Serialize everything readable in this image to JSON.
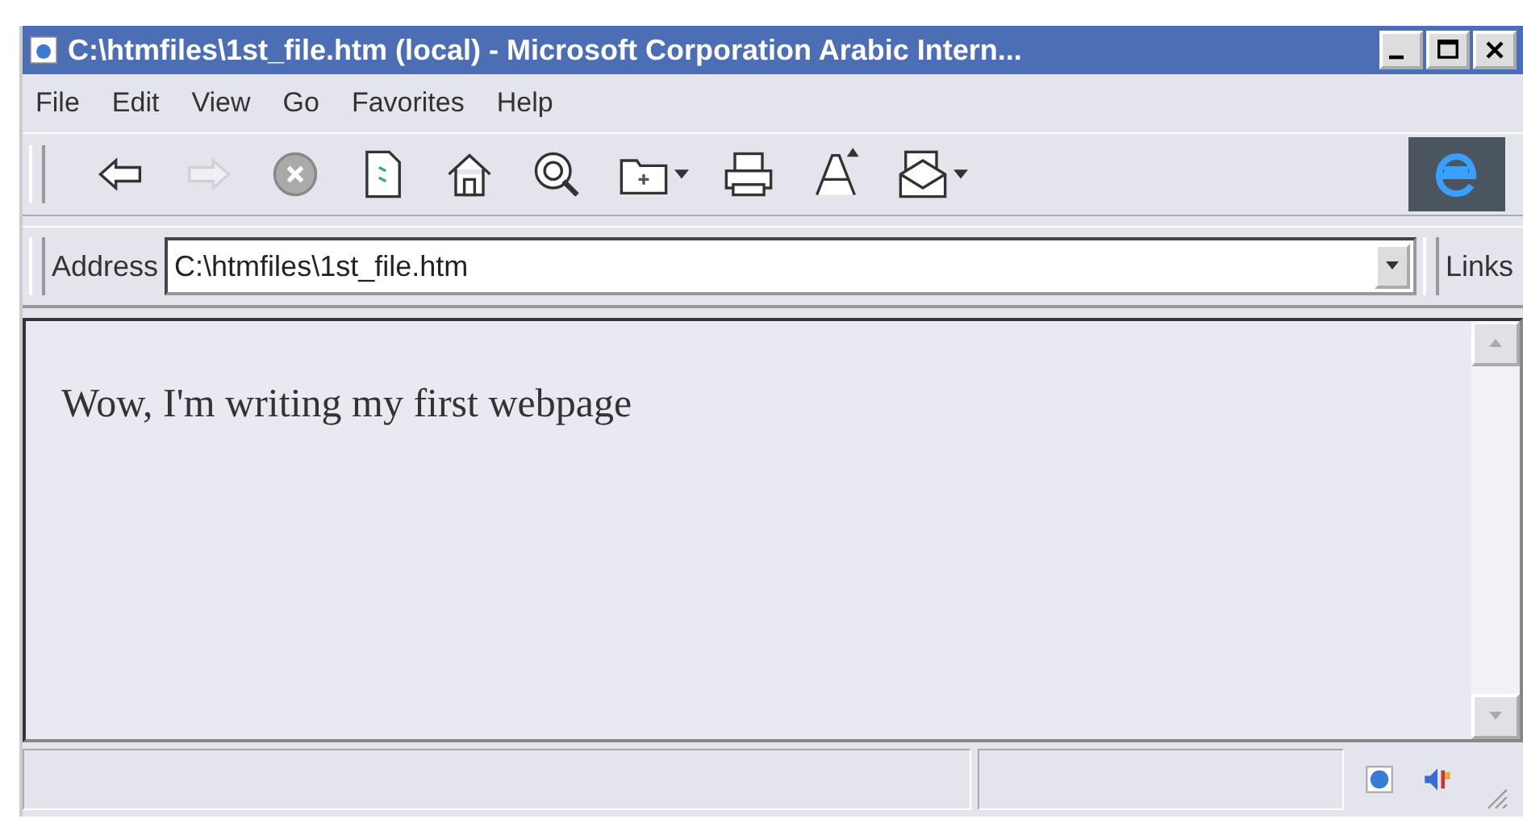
{
  "window": {
    "title": "C:\\htmfiles\\1st_file.htm (local) - Microsoft Corporation Arabic Intern..."
  },
  "menu": [
    {
      "label": "File"
    },
    {
      "label": "Edit"
    },
    {
      "label": "View"
    },
    {
      "label": "Go"
    },
    {
      "label": "Favorites"
    },
    {
      "label": "Help"
    }
  ],
  "toolbar": [
    {
      "kind": "back",
      "disabled": false,
      "has_menu": false
    },
    {
      "kind": "forward",
      "disabled": true,
      "has_menu": false
    },
    {
      "kind": "stop",
      "disabled": false,
      "has_menu": false
    },
    {
      "kind": "refresh",
      "disabled": false,
      "has_menu": false
    },
    {
      "kind": "home",
      "disabled": false,
      "has_menu": false
    },
    {
      "kind": "search",
      "disabled": false,
      "has_menu": false
    },
    {
      "kind": "folder",
      "disabled": false,
      "has_menu": true
    },
    {
      "kind": "print",
      "disabled": false,
      "has_menu": false
    },
    {
      "kind": "font",
      "disabled": false,
      "has_menu": false
    },
    {
      "kind": "mail",
      "disabled": false,
      "has_menu": true
    }
  ],
  "address": {
    "label": "Address",
    "value": "C:\\htmfiles\\1st_file.htm",
    "links": "Links"
  },
  "content": {
    "text": "Wow, I'm writing my first webpage"
  }
}
